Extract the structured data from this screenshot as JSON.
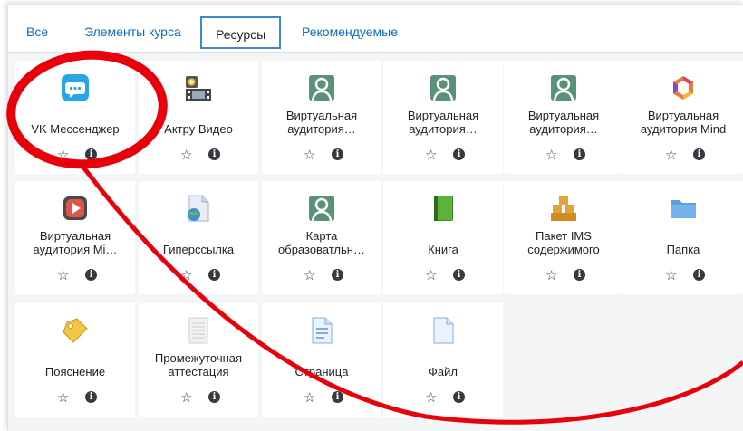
{
  "tabs": [
    {
      "label": "Все"
    },
    {
      "label": "Элементы курса"
    },
    {
      "label": "Ресурсы"
    },
    {
      "label": "Рекомендуемые"
    }
  ],
  "cards": [
    {
      "label": "VK Мессенджер",
      "icon": "vk-messenger-icon"
    },
    {
      "label": "Актру Видео",
      "icon": "aktru-video-icon"
    },
    {
      "label": "Виртуальная аудитория…",
      "icon": "virtual-classroom-icon"
    },
    {
      "label": "Виртуальная аудитория…",
      "icon": "virtual-classroom-icon"
    },
    {
      "label": "Виртуальная аудитория…",
      "icon": "virtual-classroom-icon"
    },
    {
      "label": "Виртуальная аудитория Mind",
      "icon": "mind-icon"
    },
    {
      "label": "Виртуальная аудитория Mi…",
      "icon": "play-icon"
    },
    {
      "label": "Гиперссылка",
      "icon": "hyperlink-icon"
    },
    {
      "label": "Карта образоватльн…",
      "icon": "virtual-classroom-icon"
    },
    {
      "label": "Книга",
      "icon": "book-icon"
    },
    {
      "label": "Пакет IMS содержимого",
      "icon": "ims-package-icon"
    },
    {
      "label": "Папка",
      "icon": "folder-icon"
    },
    {
      "label": "Пояснение",
      "icon": "label-tag-icon"
    },
    {
      "label": "Промежуточная аттестация",
      "icon": "attestation-icon"
    },
    {
      "label": "Страница",
      "icon": "page-icon"
    },
    {
      "label": "Файл",
      "icon": "file-icon"
    }
  ],
  "card_actions": {
    "star": "☆",
    "info": "i"
  },
  "colors": {
    "link": "#0f6cbf",
    "active_tab_border": "#3d8ad1",
    "annotation": "#e8000b"
  }
}
